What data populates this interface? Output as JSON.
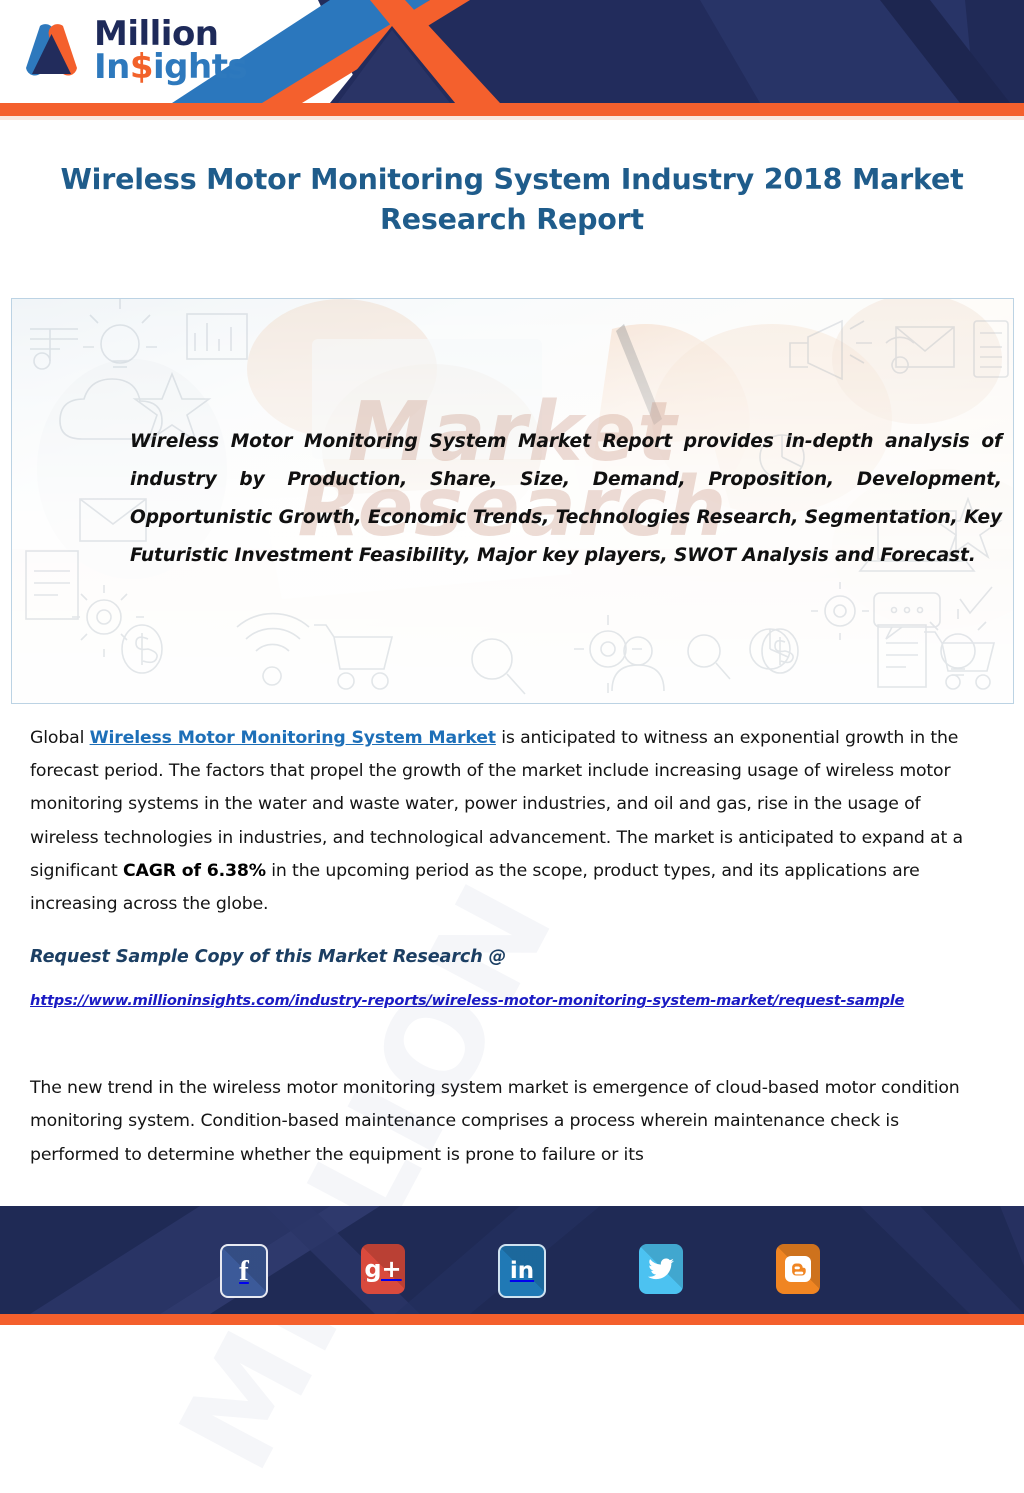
{
  "brand": {
    "logo_line1": "Million",
    "logo_line2_a": "In",
    "logo_line2_dollar": "$",
    "logo_line2_b": "ights",
    "logo_icon": "million-insights-m-logo",
    "colors": {
      "navy": "#1e2a5a",
      "blue": "#2e79bd",
      "orange": "#f4602d",
      "title_blue": "#1f5c8b",
      "link_blue": "#1d6fb8",
      "url_blue": "#1b1bc4"
    }
  },
  "page_title": "Wireless Motor Monitoring System Industry 2018 Market Research Report",
  "banner": {
    "watermark": "Market\nResearch",
    "watermark_line1": "Market",
    "watermark_line2": "Research",
    "text": "Wireless Motor Monitoring System Market Report provides in-depth analysis of industry by Production, Share, Size, Demand, Proposition, Development, Opportunistic Growth, Economic Trends, Technologies Research, Segmentation, Key Futuristic Investment Feasibility, Major key players, SWOT Analysis and Forecast.",
    "doodle_icons": [
      "lightbulb-icon",
      "bar-chart-icon",
      "star-icon",
      "cloud-icon",
      "envelope-icon",
      "document-icon",
      "gear-icon",
      "wifi-icon",
      "dollar-coin-icon",
      "shopping-cart-icon",
      "magnifier-icon",
      "megaphone-icon",
      "laptop-icon",
      "calculator-icon",
      "pie-chart-icon",
      "target-icon"
    ]
  },
  "body": {
    "watermark": "MILLION",
    "paragraph1": {
      "before_link": "Global ",
      "link": "Wireless Motor Monitoring System Market",
      "after_link": " is anticipated to witness an exponential growth in the forecast period. The factors that propel the growth of the market include increasing usage of wireless motor monitoring systems in the water and waste water, power industries, and oil and gas, rise in the usage of wireless technologies in industries, and technological advancement. The market is anticipated to expand at a significant ",
      "bold": "CAGR of 6.38%",
      "tail": " in the upcoming period as the scope, product types, and its applications are increasing across the globe."
    },
    "request_label": "Request Sample Copy of this Market Research @",
    "request_url": "https://www.millioninsights.com/industry-reports/wireless-motor-monitoring-system-market/request-sample",
    "paragraph2": "The new trend in the wireless motor monitoring system market is emergence of cloud-based motor condition monitoring system. Condition-based maintenance comprises a process wherein maintenance check is performed to determine whether the equipment is prone to failure or its"
  },
  "footer": {
    "social": [
      {
        "name": "facebook",
        "glyph": "f",
        "color": "#3c5a99",
        "class": "s-fb",
        "size": "29px"
      },
      {
        "name": "google-plus",
        "glyph": "g+",
        "color": "#d94a3d",
        "class": "s-gp",
        "size": "24px"
      },
      {
        "name": "linkedin",
        "glyph": "in",
        "color": "#2079b5",
        "class": "s-li",
        "size": "23px"
      },
      {
        "name": "twitter",
        "glyph": "ᴠ",
        "color": "#4cc2f1",
        "class": "s-tw",
        "size": "26px"
      },
      {
        "name": "blogger",
        "glyph": "B",
        "color": "#f08522",
        "class": "s-bl",
        "size": "22px"
      }
    ]
  }
}
